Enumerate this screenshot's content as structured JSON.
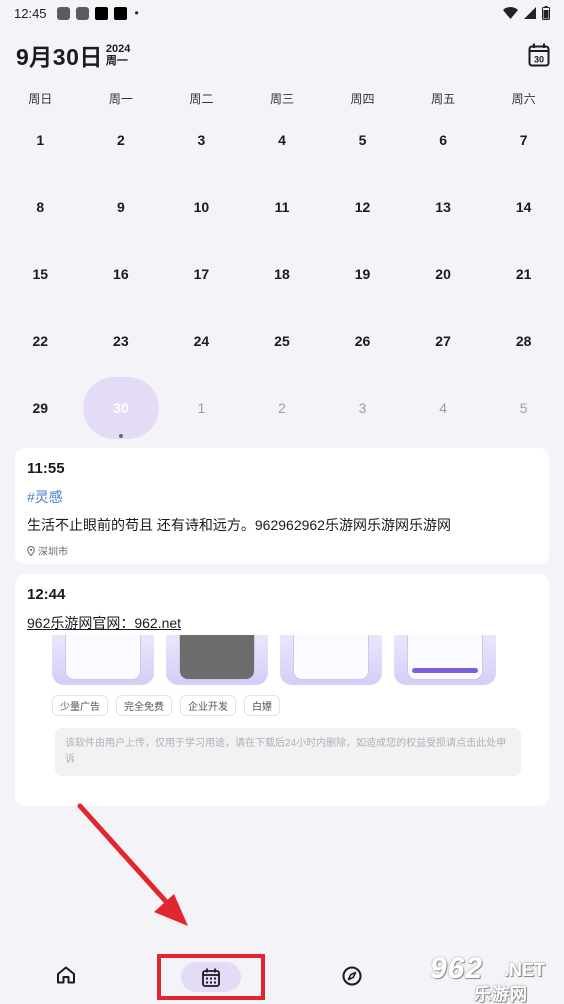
{
  "status_bar": {
    "time": "12:45"
  },
  "header": {
    "date": "9月30日",
    "year": "2024",
    "weekday": "周一",
    "calendar_badge": "30"
  },
  "weekdays": [
    "周日",
    "周一",
    "周二",
    "周三",
    "周四",
    "周五",
    "周六"
  ],
  "calendar": {
    "rows": [
      [
        "1",
        "2",
        "3",
        "4",
        "5",
        "6",
        "7"
      ],
      [
        "8",
        "9",
        "10",
        "11",
        "12",
        "13",
        "14"
      ],
      [
        "15",
        "16",
        "17",
        "18",
        "19",
        "20",
        "21"
      ],
      [
        "22",
        "23",
        "24",
        "25",
        "26",
        "27",
        "28"
      ],
      [
        "29",
        "30",
        "1",
        "2",
        "3",
        "4",
        "5"
      ]
    ],
    "selected": "30"
  },
  "entries": [
    {
      "time": "11:55",
      "tag": "#灵感",
      "text": "生活不止眼前的苟且 还有诗和远方。962962962乐游网乐游网乐游网",
      "location": "深圳市"
    },
    {
      "time": "12:44",
      "link_text": "962乐游网官网：962.net",
      "chips": [
        "少量广告",
        "完全免费",
        "企业开发",
        "白嫖"
      ],
      "notice": "该软件由用户上传，仅用于学习用途，请在下载后24小时内删除，如造成您的权益受损请点击此处申诉"
    }
  ],
  "bottom_nav": {
    "items": [
      "home-icon",
      "calendar-icon",
      "compass-icon"
    ],
    "active": "calendar-icon"
  },
  "watermark": {
    "number": "962",
    "suffix": ".NET",
    "name": "乐游网"
  },
  "colors": {
    "accent_light": "#e4dcf7",
    "tag_blue": "#4b7dc9",
    "highlight_red": "#e2262f"
  }
}
